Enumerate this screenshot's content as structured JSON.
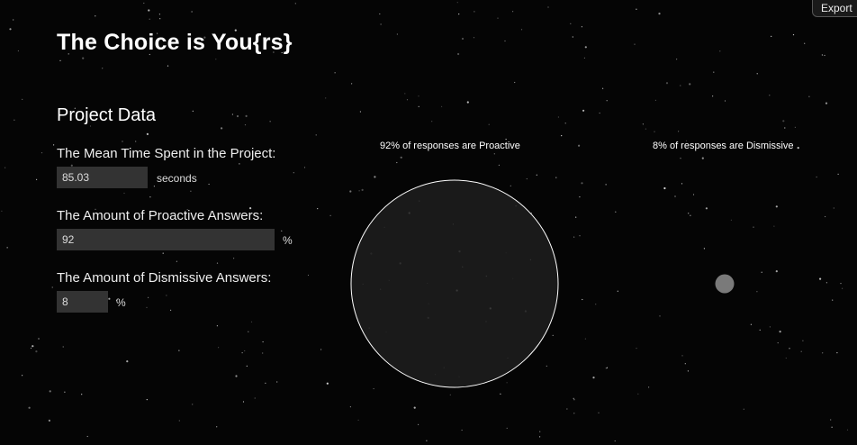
{
  "app": {
    "title": "The Choice is You{rs}",
    "export_label": "Export"
  },
  "project": {
    "section_title": "Project Data",
    "mean_time": {
      "label": "The Mean Time Spent in the Project:",
      "value": "85.03",
      "unit": "seconds"
    },
    "proactive": {
      "label": "The Amount of Proactive Answers:",
      "value": "92",
      "unit": "%"
    },
    "dismissive": {
      "label": "The Amount of Dismissive Answers:",
      "value": "8",
      "unit": "%"
    }
  },
  "visual": {
    "proactive_caption": "92% of responses are Proactive",
    "dismissive_caption": "8% of responses are Dismissive",
    "proactive_percent": 92,
    "dismissive_percent": 8,
    "proactive_color": "#1e1e1e",
    "dismissive_color": "#7a7a7a"
  }
}
